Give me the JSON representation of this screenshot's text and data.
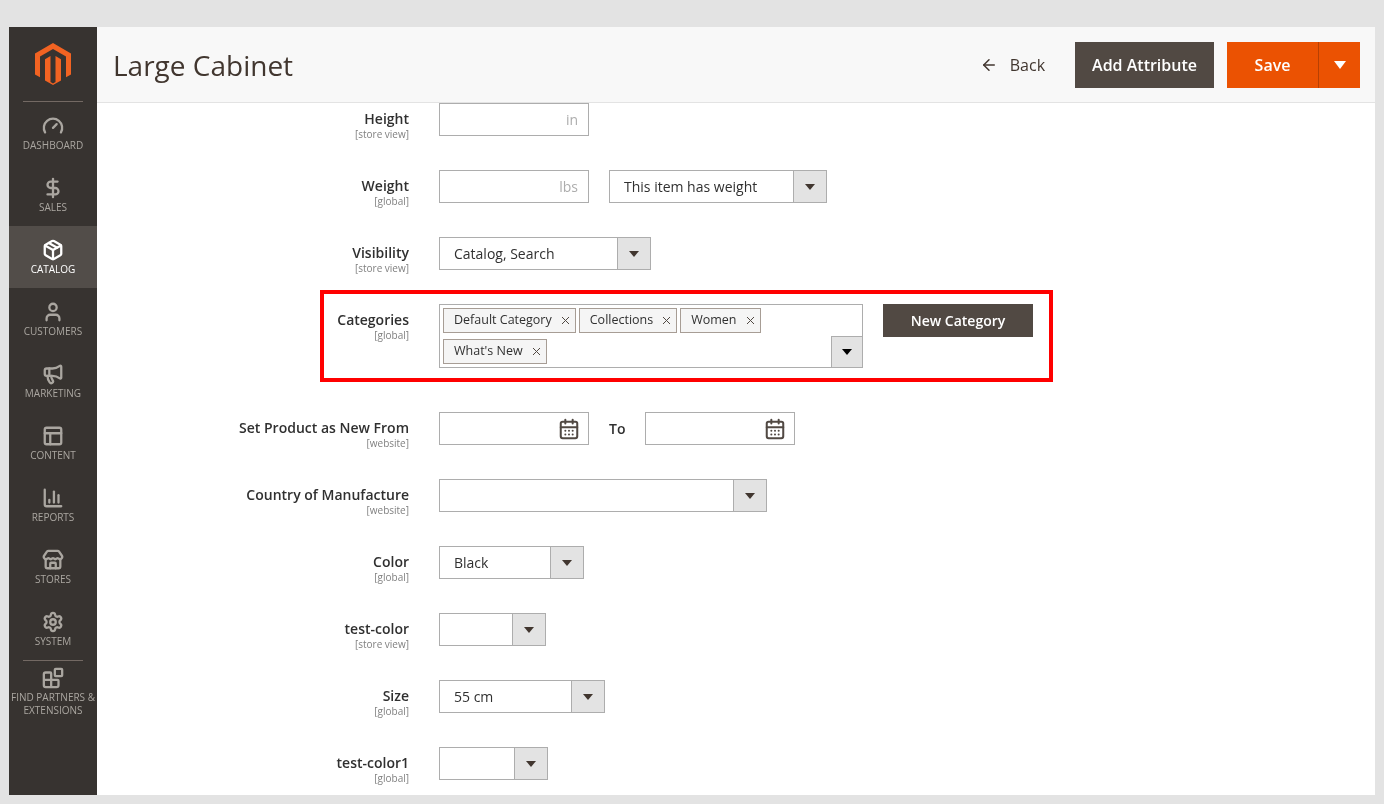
{
  "sidebar": {
    "items": [
      {
        "label": "DASHBOARD",
        "selected": false
      },
      {
        "label": "SALES",
        "selected": false
      },
      {
        "label": "CATALOG",
        "selected": true
      },
      {
        "label": "CUSTOMERS",
        "selected": false
      },
      {
        "label": "MARKETING",
        "selected": false
      },
      {
        "label": "CONTENT",
        "selected": false
      },
      {
        "label": "REPORTS",
        "selected": false
      },
      {
        "label": "STORES",
        "selected": false
      },
      {
        "label": "SYSTEM",
        "selected": false
      },
      {
        "label": "FIND PARTNERS & EXTENSIONS",
        "selected": false
      }
    ]
  },
  "header": {
    "title": "Large Cabinet",
    "back": "Back",
    "add_attribute": "Add Attribute",
    "save": "Save"
  },
  "fields": [
    {
      "label": "Height",
      "scope": "[store view]",
      "highlighted": false,
      "controls": [
        {
          "kind": "text",
          "unit": "in"
        }
      ]
    },
    {
      "label": "Weight",
      "scope": "[global]",
      "highlighted": false,
      "controls": [
        {
          "kind": "text",
          "unit": "lbs"
        },
        {
          "kind": "select",
          "value": "This item has weight"
        }
      ]
    },
    {
      "label": "Visibility",
      "scope": "[store view]",
      "highlighted": false,
      "controls": [
        {
          "kind": "select",
          "value": "Catalog, Search"
        }
      ]
    },
    {
      "label": "Categories",
      "scope": "[global]",
      "highlighted": true,
      "controls": [
        {
          "kind": "tags",
          "tags": [
            "Default Category",
            "Collections",
            "Women",
            "What's New"
          ]
        },
        {
          "kind": "button",
          "label": "New Category"
        }
      ]
    },
    {
      "label": "Set Product as New From",
      "scope": "[website]",
      "highlighted": false,
      "controls": [
        {
          "kind": "date"
        },
        {
          "kind": "caption",
          "label": "To"
        },
        {
          "kind": "date"
        }
      ]
    },
    {
      "label": "Country of Manufacture",
      "scope": "[website]",
      "highlighted": false,
      "controls": [
        {
          "kind": "select"
        }
      ]
    },
    {
      "label": "Color",
      "scope": "[global]",
      "highlighted": false,
      "controls": [
        {
          "kind": "select",
          "value": "Black"
        }
      ]
    },
    {
      "label": "test-color",
      "scope": "[store view]",
      "highlighted": false,
      "controls": [
        {
          "kind": "select"
        }
      ]
    },
    {
      "label": "Size",
      "scope": "[global]",
      "highlighted": false,
      "controls": [
        {
          "kind": "select",
          "value": "55 cm"
        }
      ]
    },
    {
      "label": "test-color1",
      "scope": "[global]",
      "highlighted": false,
      "controls": [
        {
          "kind": "select"
        }
      ]
    }
  ]
}
